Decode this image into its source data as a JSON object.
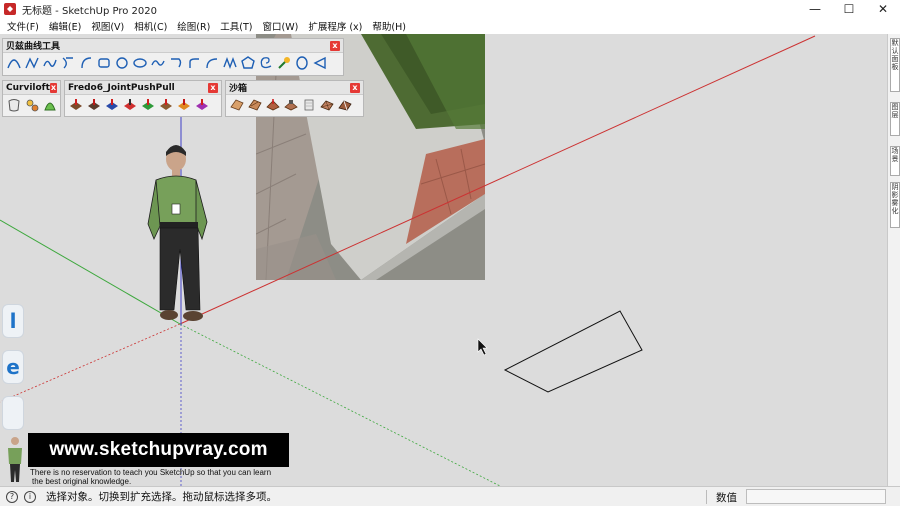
{
  "window": {
    "title": "无标题 - SketchUp Pro 2020",
    "min": "—",
    "max": "☐",
    "close": "✕"
  },
  "menu": [
    "文件(F)",
    "编辑(E)",
    "视图(V)",
    "相机(C)",
    "绘图(R)",
    "工具(T)",
    "窗口(W)",
    "扩展程序 (x)",
    "帮助(H)"
  ],
  "toolbars": {
    "bezier": {
      "title": "贝兹曲线工具",
      "close": "x"
    },
    "curviloft": {
      "title": "Curviloft",
      "close": "x"
    },
    "jointpushpull": {
      "title": "Fredo6_JointPushPull",
      "close": "x"
    },
    "sandbox": {
      "title": "沙箱",
      "close": "x"
    }
  },
  "dock_tabs": [
    "默认面板",
    "图层",
    "场景",
    "阴影雾化"
  ],
  "side_pills": [
    "l",
    "e",
    ""
  ],
  "watermark": {
    "url": "www.sketchupvray.com",
    "tagline_1": "There is no reservation to teach you SketchUp so that you can learn",
    "tagline_2": "the best original knowledge."
  },
  "status": {
    "message": "选择对象。切换到扩充选择。拖动鼠标选择多项。",
    "measurements_label": "数值",
    "measurements_value": ""
  }
}
